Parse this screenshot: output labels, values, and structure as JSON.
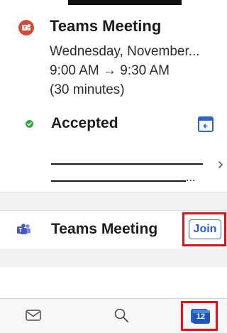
{
  "event": {
    "title": "Teams Meeting",
    "date": "Wednesday, November...",
    "time": "9:00 AM → 9:30 AM",
    "duration": "(30 minutes)"
  },
  "response": {
    "status": "Accepted"
  },
  "attendees": {
    "ellipsis": "..."
  },
  "meeting_link": {
    "label": "Teams Meeting",
    "join_label": "Join"
  },
  "tabbar": {
    "calendar_date": "12"
  },
  "colors": {
    "teams_red": "#d14a3a",
    "accepted_green": "#3aa348",
    "accent_blue": "#2b5fbf",
    "highlight_red": "#e0111a"
  },
  "icons": {
    "event_app": "teams-icon",
    "status": "check-icon",
    "calendar": "calendar-icon",
    "chevron": "chevron-right-icon",
    "mail": "mail-icon",
    "search": "search-icon",
    "calendar_tab": "calendar-tab-icon"
  }
}
